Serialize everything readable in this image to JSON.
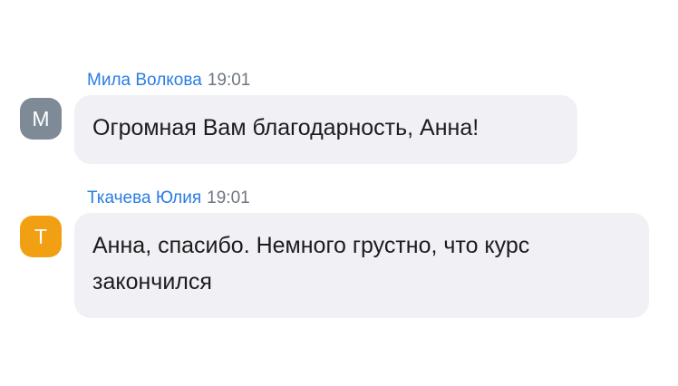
{
  "messages": [
    {
      "author": "Мила Волкова",
      "time": "19:01",
      "avatar_initial": "М",
      "avatar_color": "#7e8b97",
      "text": "Огромная Вам благодарность, Анна!"
    },
    {
      "author": "Ткачева Юлия",
      "time": "19:01",
      "avatar_initial": "Т",
      "avatar_color": "#f2a013",
      "text_line_1": "Анна, спасибо. Немного грустно, что курс",
      "text_line_2": "закончился"
    }
  ]
}
